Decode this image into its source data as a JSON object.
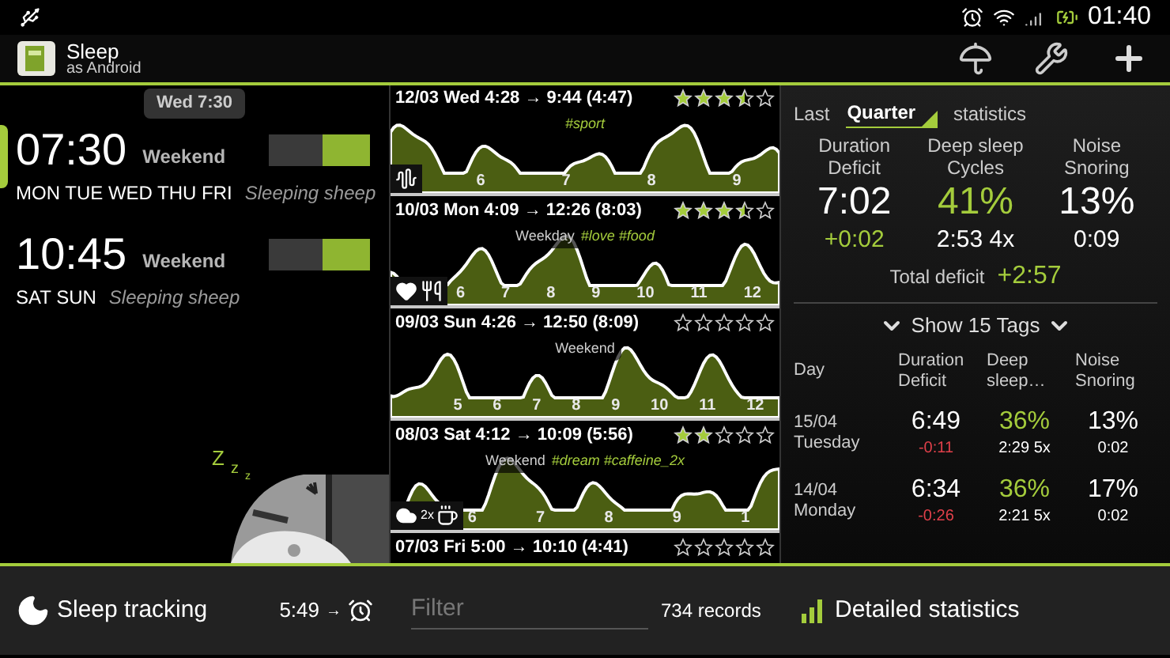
{
  "status_bar": {
    "time": "01:40"
  },
  "action_bar": {
    "title": "Sleep",
    "subtitle": "as Android"
  },
  "toast": "Wed 7:30",
  "alarms": [
    {
      "time": "07:30",
      "label": "Weekend",
      "days": "MON TUE WED THU FRI",
      "sound": "Sleeping sheep",
      "on": true,
      "selected": true
    },
    {
      "time": "10:45",
      "label": "Weekend",
      "days": "SAT SUN",
      "sound": "Sleeping sheep",
      "on": true,
      "selected": false
    }
  ],
  "snore_letters": [
    "Z",
    "z",
    "z"
  ],
  "records": [
    {
      "title": "12/03 Wed 4:28 → 9:44 (4:47)",
      "stars": 3.5,
      "hashtags": "#sport",
      "hours": [
        "6",
        "7",
        "8",
        "9"
      ],
      "icons": [
        {
          "kind": "waves"
        }
      ]
    },
    {
      "title": "10/03 Mon 4:09 → 12:26 (8:03)",
      "stars": 3.5,
      "label": "Weekday",
      "hashtags": "#love #food",
      "hours": [
        "6",
        "7",
        "8",
        "9",
        "10",
        "11",
        "12"
      ],
      "icons": [
        {
          "kind": "heart"
        },
        {
          "kind": "food"
        }
      ]
    },
    {
      "title": "09/03 Sun 4:26 → 12:50 (8:09)",
      "stars": 0,
      "label": "Weekend",
      "hours": [
        "5",
        "6",
        "7",
        "8",
        "9",
        "10",
        "11",
        "12"
      ]
    },
    {
      "title": "08/03 Sat 4:12 → 10:09 (5:56)",
      "stars": 2,
      "label": "Weekend",
      "hashtags": "#dream #caffeine_2x",
      "hours": [
        "6",
        "7",
        "8",
        "9",
        "1"
      ],
      "icons": [
        {
          "kind": "cloud",
          "count": "2x"
        },
        {
          "kind": "cup"
        }
      ]
    },
    {
      "title": "07/03 Fri 5:00 → 10:10 (4:41)",
      "stars": 0
    }
  ],
  "stats": {
    "prefix": "Last",
    "period": "Quarter",
    "suffix": "statistics",
    "columns": [
      {
        "header": [
          "Duration",
          "Deficit"
        ],
        "value": "7:02",
        "value_highlight": false,
        "sub": "+0:02",
        "sub_highlight": true
      },
      {
        "header": [
          "Deep sleep",
          "Cycles"
        ],
        "value": "41%",
        "value_highlight": true,
        "sub": "2:53 4x",
        "sub_highlight": false
      },
      {
        "header": [
          "Noise",
          "Snoring"
        ],
        "value": "13%",
        "value_highlight": false,
        "sub": "0:09",
        "sub_highlight": false
      }
    ],
    "total_label": "Total deficit",
    "total_value": "+2:57",
    "tags_toggle": "Show 15 Tags",
    "table": {
      "columns": [
        [
          "Day"
        ],
        [
          "Duration",
          "Deficit"
        ],
        [
          "Deep",
          "sleep…"
        ],
        [
          "Noise",
          "Snoring"
        ]
      ],
      "rows": [
        {
          "date": "15/04",
          "weekday": "Tuesday",
          "duration": "6:49",
          "deficit": "-0:11",
          "deep": "36%",
          "deep_sub": "2:29 5x",
          "noise": "13%",
          "noise_sub": "0:02"
        },
        {
          "date": "14/04",
          "weekday": "Monday",
          "duration": "6:34",
          "deficit": "-0:26",
          "deep": "36%",
          "deep_sub": "2:21 5x",
          "noise": "17%",
          "noise_sub": "0:02"
        }
      ]
    }
  },
  "bottom_bar": {
    "tracking": "Sleep tracking",
    "next_alarm": "5:49",
    "arrow": "→",
    "filter_placeholder": "Filter",
    "records_count": "734 records",
    "detailed": "Detailed statistics"
  }
}
